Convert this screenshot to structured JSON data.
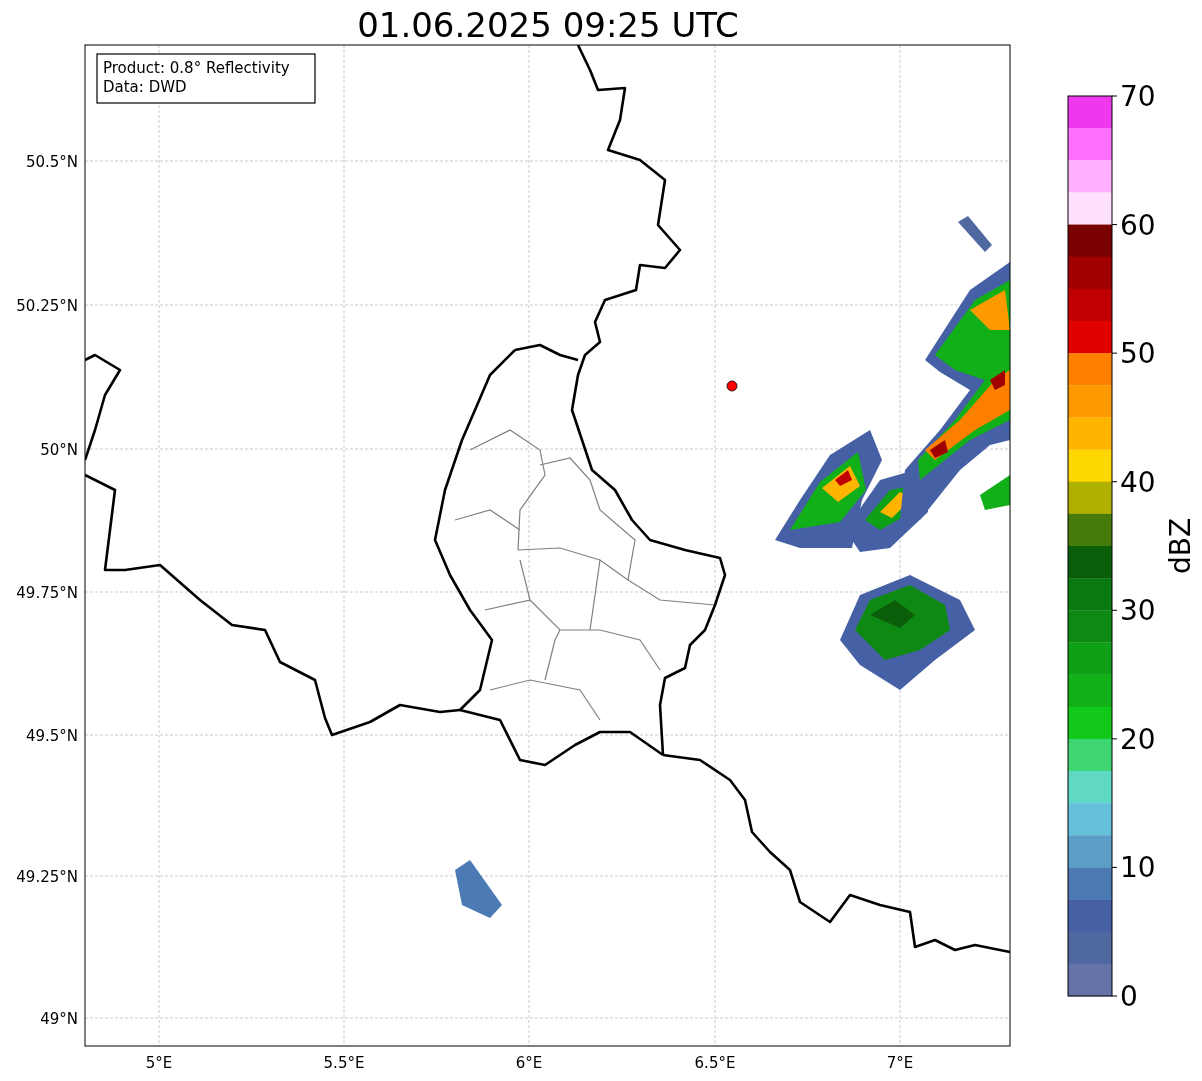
{
  "title": "01.06.2025 09:25 UTC",
  "map": {
    "info_lines": [
      "Product: 0.8° Reflectivity",
      "Data: DWD"
    ],
    "x_ticks": [
      "5°E",
      "5.5°E",
      "6°E",
      "6.5°E",
      "7°E"
    ],
    "y_ticks": [
      "50.5°N",
      "50.25°N",
      "50°N",
      "49.75°N",
      "49.5°N",
      "49.25°N",
      "49°N"
    ]
  },
  "colorbar": {
    "label": "dBZ",
    "ticks": [
      "70",
      "60",
      "50",
      "40",
      "30",
      "20",
      "10",
      "0"
    ],
    "bins": [
      {
        "color": "#ee38ee"
      },
      {
        "color": "#ff70ff"
      },
      {
        "color": "#ffb0ff"
      },
      {
        "color": "#ffe0ff"
      },
      {
        "color": "#780000"
      },
      {
        "color": "#a00000"
      },
      {
        "color": "#c00000"
      },
      {
        "color": "#e00000"
      },
      {
        "color": "#ff8000"
      },
      {
        "color": "#ff9900"
      },
      {
        "color": "#ffb400"
      },
      {
        "color": "#ffd700"
      },
      {
        "color": "#b0b000"
      },
      {
        "color": "#467a0a"
      },
      {
        "color": "#0a5e0a"
      },
      {
        "color": "#0a7a10"
      },
      {
        "color": "#0e8a14"
      },
      {
        "color": "#10a018"
      },
      {
        "color": "#12b018"
      },
      {
        "color": "#12c818"
      },
      {
        "color": "#3ed672"
      },
      {
        "color": "#5fd8c4"
      },
      {
        "color": "#65c0dc"
      },
      {
        "color": "#5b9fc8"
      },
      {
        "color": "#4b7ab4"
      },
      {
        "color": "#4560a5"
      },
      {
        "color": "#5068a0"
      },
      {
        "color": "#6473a8"
      }
    ]
  }
}
